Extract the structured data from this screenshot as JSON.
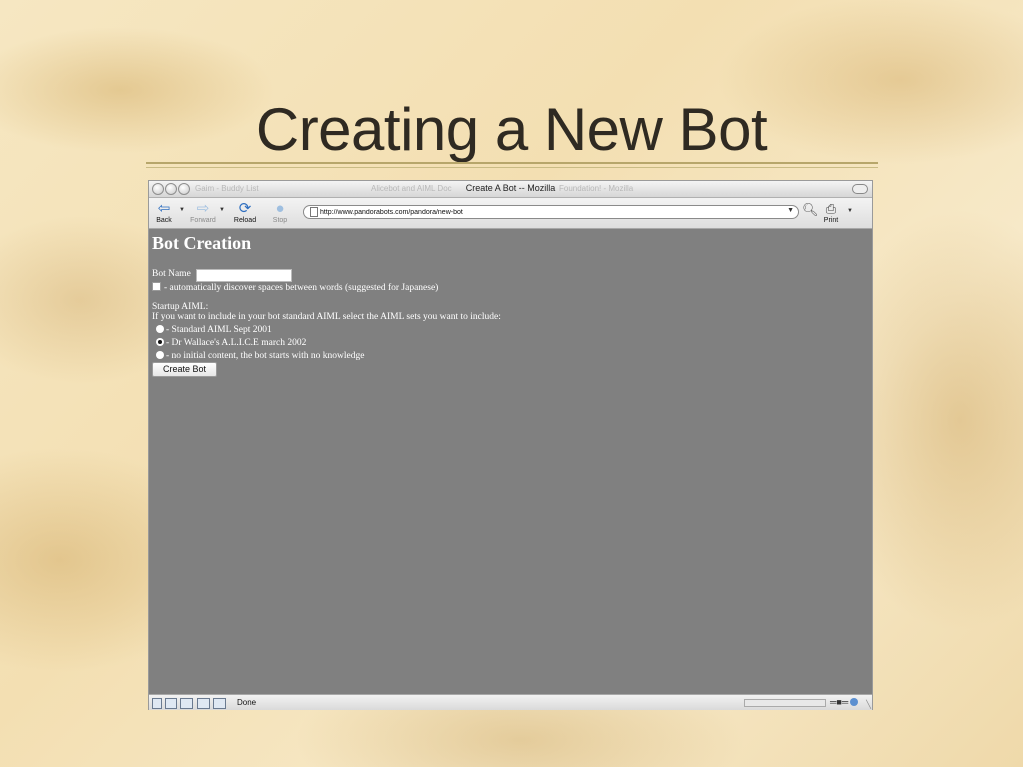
{
  "slide": {
    "title": "Creating a New Bot"
  },
  "browser": {
    "window_title": "Create A Bot -- Mozilla",
    "ghost_tab_left": "Gaim - Buddy List",
    "ghost_tab_mid": "Alicebot and AIML Doc",
    "ghost_tab_right": "Foundation! - Mozilla",
    "nav": {
      "back": "Back",
      "forward": "Forward",
      "reload": "Reload",
      "stop": "Stop",
      "print": "Print"
    },
    "url": "http://www.pandorabots.com/pandora/new-bot",
    "status": "Done"
  },
  "page": {
    "heading": "Bot Creation",
    "bot_name_label": "Bot Name",
    "bot_name_value": "",
    "discover_spaces_label": "- automatically discover spaces between words (suggested for Japanese)",
    "startup_label": "Startup AIML:",
    "startup_help": "If you want to include in your bot standard AIML select the AIML sets you want to include:",
    "options": [
      {
        "label": "- Standard AIML Sept 2001",
        "selected": false
      },
      {
        "label": "- Dr Wallace's A.L.I.C.E march 2002",
        "selected": true
      },
      {
        "label": "- no initial content, the bot starts with no knowledge",
        "selected": false
      }
    ],
    "create_button": "Create Bot"
  }
}
